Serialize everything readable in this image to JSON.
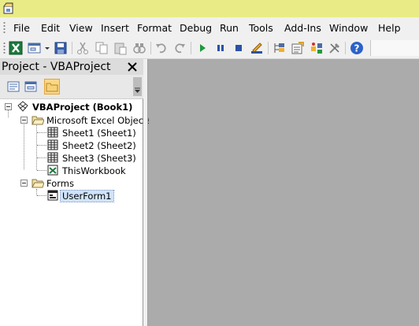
{
  "menu": [
    "File",
    "Edit",
    "View",
    "Insert",
    "Format",
    "Debug",
    "Run",
    "Tools",
    "Add-Ins",
    "Window",
    "Help"
  ],
  "project_explorer": {
    "title": "Project - VBAProject",
    "tree": {
      "root": "VBAProject (Book1)",
      "excel_objects_folder": "Microsoft Excel Objects",
      "sheets": [
        "Sheet1 (Sheet1)",
        "Sheet2 (Sheet2)",
        "Sheet3 (Sheet3)"
      ],
      "workbook": "ThisWorkbook",
      "forms_folder": "Forms",
      "forms": [
        "UserForm1"
      ]
    }
  },
  "colors": {
    "titlebar": "#e9eb87",
    "selected_tool": "#fcd784",
    "workspace": "#ababab"
  },
  "icons": {
    "toolbar": [
      "excel-icon",
      "insert-userform-icon",
      "save-icon",
      "cut-icon",
      "copy-icon",
      "paste-icon",
      "find-icon",
      "undo-icon",
      "redo-icon",
      "run-icon",
      "break-icon",
      "reset-icon",
      "design-mode-icon",
      "project-explorer-icon",
      "properties-icon",
      "object-browser-icon",
      "toolbox-icon",
      "help-icon"
    ],
    "project_toolbar": [
      "view-code-icon",
      "view-object-icon",
      "toggle-folders-icon"
    ]
  }
}
